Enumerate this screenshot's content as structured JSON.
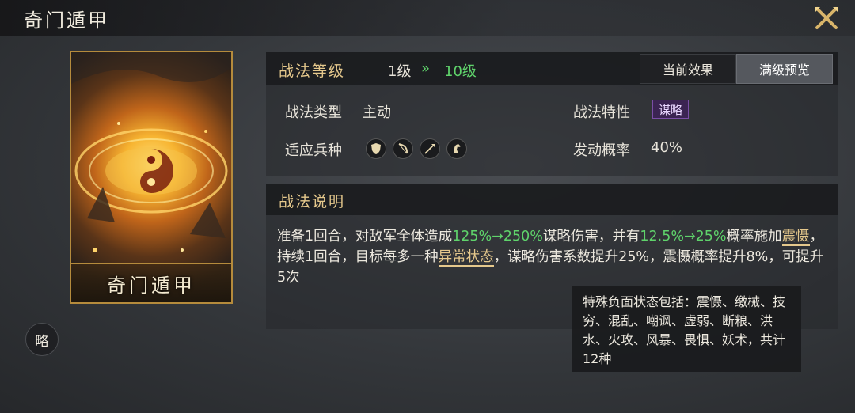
{
  "window": {
    "title": "奇门遁甲"
  },
  "card": {
    "name": "奇门遁甲"
  },
  "badge": {
    "label": "略"
  },
  "level": {
    "label": "战法等级",
    "current": "1级",
    "arrow": "»",
    "max": "10级"
  },
  "tabs": {
    "current_effect": "当前效果",
    "max_preview": "满级预览"
  },
  "fields": {
    "type_label": "战法类型",
    "type_value": "主动",
    "trait_label": "战法特性",
    "trait_value": "谋略",
    "units_label": "适应兵种",
    "units": [
      "shield-icon",
      "bow-icon",
      "spear-icon",
      "horse-icon"
    ],
    "trigger_label": "发动概率",
    "trigger_value": "40%"
  },
  "description": {
    "label": "战法说明",
    "p1": "准备1回合，对敌军全体造成",
    "dmg": "125%→250%",
    "p2": "谋略伤害，并有",
    "chance": "12.5%→25%",
    "p3": "概率施加",
    "status": "震慑",
    "p4": "，持续1回合，目标每多一种",
    "abnormal": "异常状态",
    "p5": "，谋略伤害系数提升25%，震慑概率提升8%，可提升5次"
  },
  "tooltip": {
    "text": "特殊负面状态包括：震慑、缴械、技穷、混乱、嘲讽、虚弱、断粮、洪水、火攻、风暴、畏惧、妖术，共计12种"
  },
  "colors": {
    "accent_green": "#5fd36b",
    "gold": "#e5c88c",
    "purple_tag": "#3b2452"
  }
}
